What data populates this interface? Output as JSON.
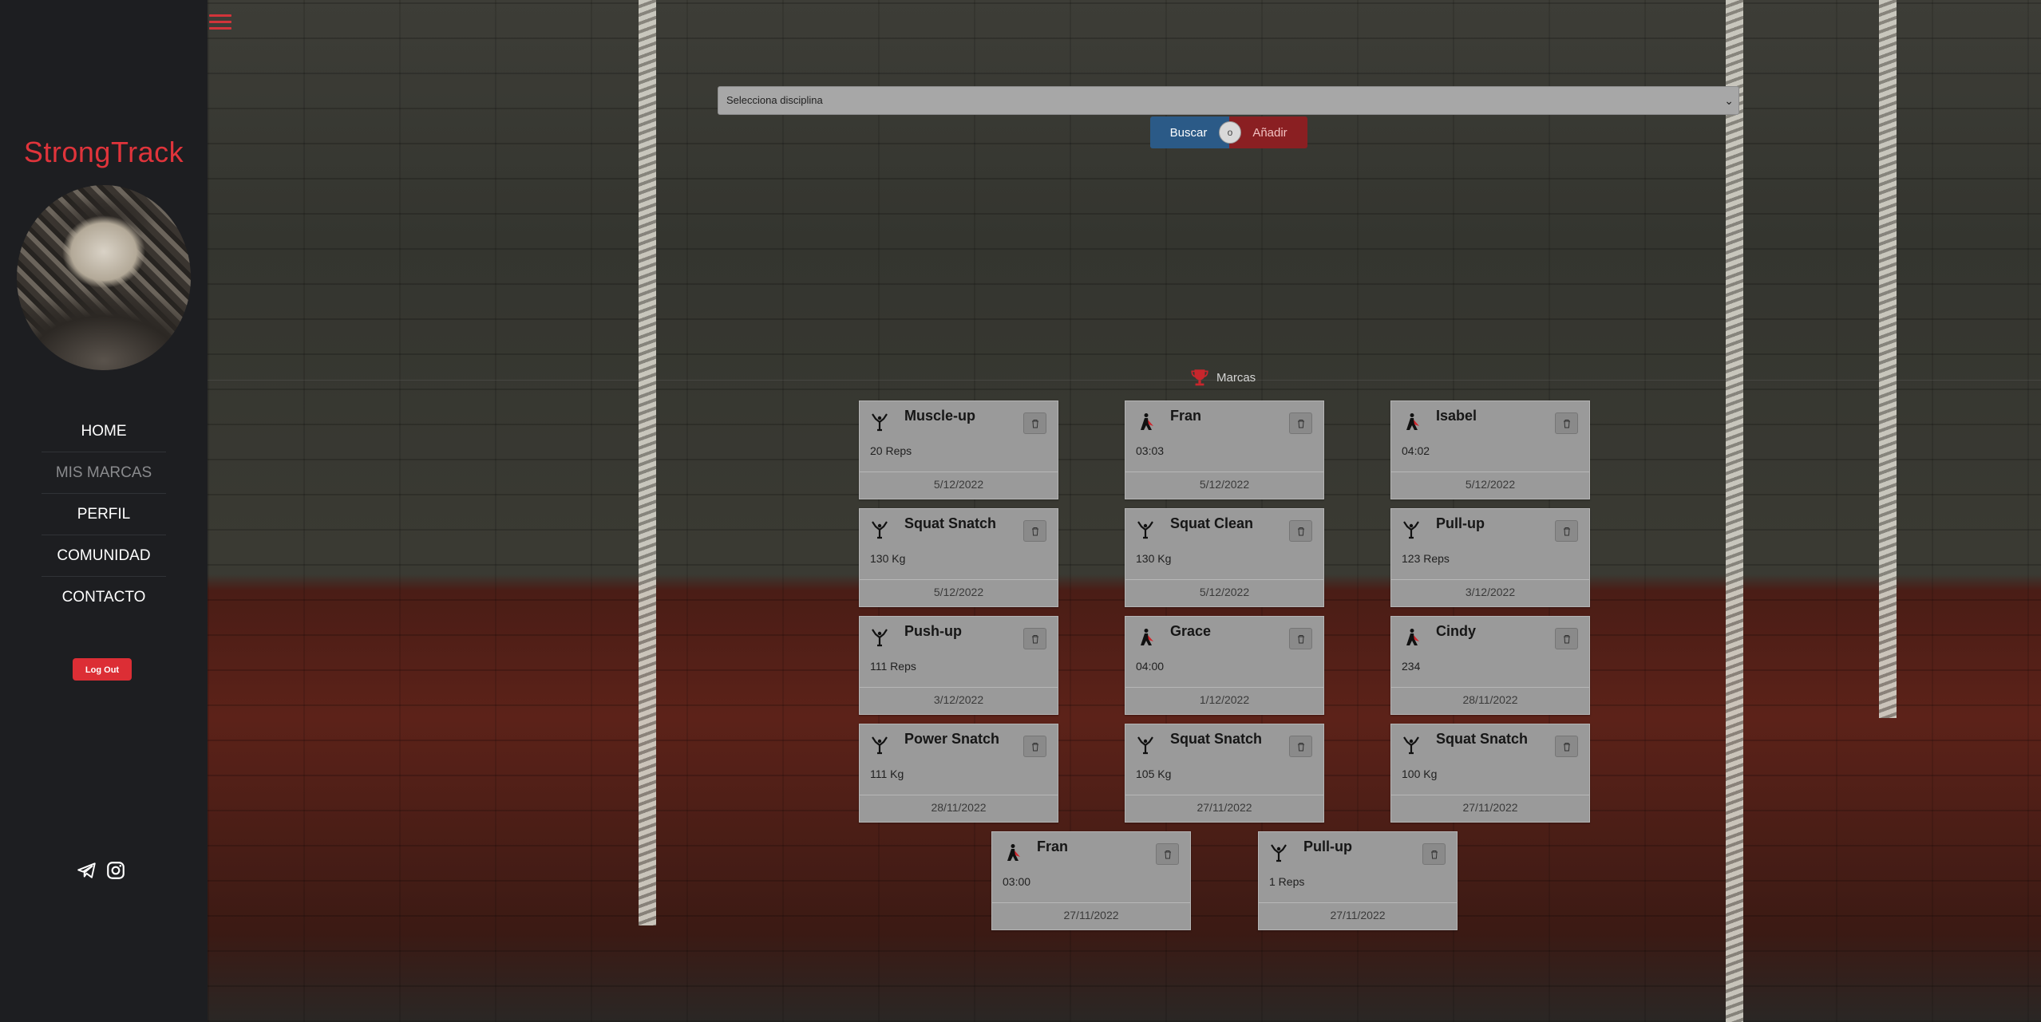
{
  "app": {
    "brand": "StrongTrack"
  },
  "sidebar": {
    "nav": [
      {
        "label": "HOME",
        "active": false
      },
      {
        "label": "MIS MARCAS",
        "active": true
      },
      {
        "label": "PERFIL",
        "active": false
      },
      {
        "label": "COMUNIDAD",
        "active": false
      },
      {
        "label": "CONTACTO",
        "active": false
      }
    ],
    "logout_label": "Log Out",
    "socials": [
      "telegram-icon",
      "instagram-icon"
    ]
  },
  "search": {
    "select_value": "Selecciona disciplina",
    "buscar_label": "Buscar",
    "or_label": "o",
    "anadir_label": "Añadir"
  },
  "marks_section": {
    "title": "Marcas",
    "icon": "trophy-icon"
  },
  "records": [
    {
      "type": "barbell",
      "name": "Muscle-up",
      "value": "20 Reps",
      "date": "5/12/2022"
    },
    {
      "type": "wod",
      "name": "Fran",
      "value": "03:03",
      "date": "5/12/2022"
    },
    {
      "type": "wod",
      "name": "Isabel",
      "value": "04:02",
      "date": "5/12/2022"
    },
    {
      "type": "barbell",
      "name": "Squat Snatch",
      "value": "130 Kg",
      "date": "5/12/2022"
    },
    {
      "type": "barbell",
      "name": "Squat Clean",
      "value": "130 Kg",
      "date": "5/12/2022"
    },
    {
      "type": "barbell",
      "name": "Pull-up",
      "value": "123 Reps",
      "date": "3/12/2022"
    },
    {
      "type": "barbell",
      "name": "Push-up",
      "value": "111 Reps",
      "date": "3/12/2022"
    },
    {
      "type": "wod",
      "name": "Grace",
      "value": "04:00",
      "date": "1/12/2022"
    },
    {
      "type": "wod",
      "name": "Cindy",
      "value": "234",
      "date": "28/11/2022"
    },
    {
      "type": "barbell",
      "name": "Power Snatch",
      "value": "111 Kg",
      "date": "28/11/2022"
    },
    {
      "type": "barbell",
      "name": "Squat Snatch",
      "value": "105 Kg",
      "date": "27/11/2022"
    },
    {
      "type": "barbell",
      "name": "Squat Snatch",
      "value": "100 Kg",
      "date": "27/11/2022"
    },
    {
      "type": "wod",
      "name": "Fran",
      "value": "03:00",
      "date": "27/11/2022"
    },
    {
      "type": "barbell",
      "name": "Pull-up",
      "value": "1 Reps",
      "date": "27/11/2022"
    }
  ],
  "colors": {
    "brand_red": "#e0343b",
    "buscar_blue": "#2b5a87",
    "anadir_red": "#8a1f22"
  }
}
